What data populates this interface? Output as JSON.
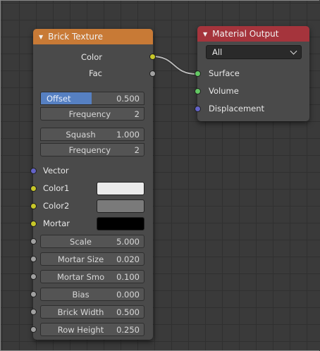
{
  "brick_node": {
    "title": "Brick Texture",
    "outputs": [
      "Color",
      "Fac"
    ],
    "offset": {
      "label": "Offset",
      "value": "0.500"
    },
    "frequency1": {
      "label": "Frequency",
      "value": "2"
    },
    "squash": {
      "label": "Squash",
      "value": "1.000"
    },
    "frequency2": {
      "label": "Frequency",
      "value": "2"
    },
    "inputs": {
      "vector": "Vector",
      "color1": "Color1",
      "color2": "Color2",
      "mortar": "Mortar"
    },
    "swatch_colors": {
      "color1": "#ebebeb",
      "color2": "#7a7a7a",
      "mortar": "#000000"
    },
    "params": [
      {
        "label": "Scale",
        "value": "5.000"
      },
      {
        "label": "Mortar Size",
        "value": "0.020"
      },
      {
        "label": "Mortar Smo",
        "value": "0.100"
      },
      {
        "label": "Bias",
        "value": "0.000"
      },
      {
        "label": "Brick Width",
        "value": "0.500"
      },
      {
        "label": "Row Height",
        "value": "0.250"
      }
    ]
  },
  "output_node": {
    "title": "Material Output",
    "target": "All",
    "inputs": [
      "Surface",
      "Volume",
      "Displacement"
    ]
  },
  "colors": {
    "brick_header": "#c87a36",
    "output_header": "#a5343c",
    "socket_color": "#c7c729",
    "socket_float": "#a1a1a1",
    "socket_vector": "#6363c7",
    "socket_shader": "#63c763",
    "selected_field": "#5680c2"
  }
}
